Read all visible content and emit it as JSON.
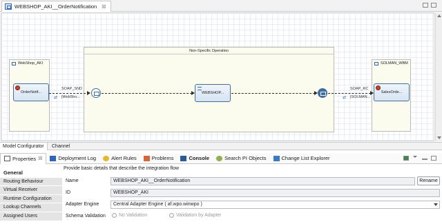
{
  "editor": {
    "tab_title": "WEBSHOP_AKI__OrderNotification",
    "tab_close": "☒"
  },
  "canvas": {
    "sender_pool": "WebShop_AKI",
    "sender_task": "OrderNotif...",
    "operation_title": "Non-Specific Operation",
    "inner_task": "WEBSHOP...",
    "receiver_pool": "SOLMAN_WBM",
    "receiver_task": "SalesOrde...",
    "sender_channel": "SOAP_SND",
    "sender_channel_sub": "|WebSho...",
    "receiver_channel": "SOAP_RC",
    "receiver_channel_sub": "|SOLMAN..."
  },
  "model_tabs": [
    "Model Configurator",
    "Channel"
  ],
  "view_tabs": [
    {
      "label": "Properties",
      "icon": "properties-icon",
      "suffix": "☒"
    },
    {
      "label": "Deployment Log",
      "icon": "deployment-log-icon"
    },
    {
      "label": "Alert Rules",
      "icon": "alert-rules-icon"
    },
    {
      "label": "Problems",
      "icon": "problems-icon"
    },
    {
      "label": "Console",
      "icon": "console-icon"
    },
    {
      "label": "Search PI Objects",
      "icon": "search-pi-icon"
    },
    {
      "label": "Change List Explorer",
      "icon": "change-list-icon"
    }
  ],
  "sidebar": {
    "items": [
      "General",
      "Routing Behaviour",
      "Virtual Receiver",
      "Runtime Configuration",
      "Lookup Channels",
      "Assigned Users"
    ]
  },
  "general": {
    "description": "Provide basic details that describe the integration flow",
    "name_label": "Name",
    "name_value": "WEBSHOP_AKI__OrderNotification",
    "rename_button": "Rename",
    "id_label": "ID",
    "id_value": "WEBSHOP_AKI",
    "adapter_label": "Adapter Engine",
    "adapter_value": "Central Adapter Engine ( af.wpo.winwpo )",
    "schema_label": "Schema Validation",
    "schema_options": [
      "No Validation",
      "Validation by Adapter"
    ]
  },
  "colors": {
    "accent": "#3d6ea8",
    "pool_bg": "#fcfcee",
    "sender_badge": "#d0402a"
  }
}
